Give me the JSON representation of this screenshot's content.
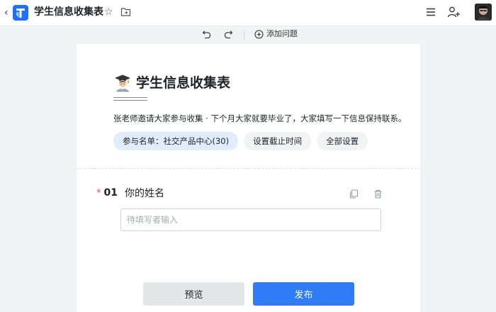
{
  "topbar": {
    "back_glyph": "‹",
    "title": "学生信息收集表",
    "icons": [
      "back-icon",
      "app-logo-icon",
      "star-icon",
      "move-to-folder-icon",
      "menu-icon",
      "add-collaborator-icon",
      "avatar"
    ]
  },
  "toolbar": {
    "add_question_label": "添加问题",
    "icons": [
      "undo-icon",
      "redo-icon",
      "plus-circle-icon"
    ]
  },
  "form": {
    "title": "学生信息收集表",
    "title_emoji": "student-emoji",
    "description": "张老师邀请大家参与收集 · 下个月大家就要毕业了，大家填写一下信息保持联系。",
    "chips": [
      {
        "label": "参与名单：社交产品中心(30)"
      },
      {
        "label": "设置截止时间"
      },
      {
        "label": "全部设置"
      }
    ],
    "questions": [
      {
        "required_mark": "*",
        "number": "01",
        "title": "你的姓名",
        "placeholder": "待填写者输入"
      }
    ]
  },
  "actions": {
    "preview_label": "预览",
    "publish_label": "发布"
  },
  "colors": {
    "accent": "#2f7cf6",
    "chip_primary_bg": "#e1ecff",
    "required": "#f54a45",
    "page_bg": "#f2f3f5"
  }
}
